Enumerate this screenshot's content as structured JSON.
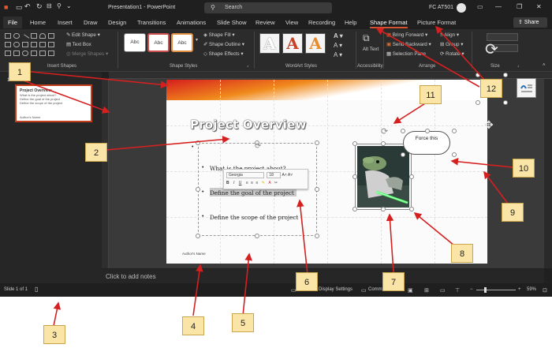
{
  "titlebar": {
    "title": "Presentation1 - PowerPoint",
    "search_placeholder": "Search",
    "user": "FC AT501"
  },
  "tabs": [
    "File",
    "Home",
    "Insert",
    "Draw",
    "Design",
    "Transitions",
    "Animations",
    "Slide Show",
    "Review",
    "View",
    "Recording",
    "Help",
    "Shape Format",
    "Picture Format"
  ],
  "share_label": "Share",
  "ribbon": {
    "insert_shapes": {
      "label": "Insert Shapes",
      "edit_shape": "Edit Shape",
      "text_box": "Text Box",
      "merge_shapes": "Merge Shapes"
    },
    "shape_styles": {
      "label": "Shape Styles",
      "style_sample": "Abc",
      "fill": "Shape Fill",
      "outline": "Shape Outline",
      "effects": "Shape Effects"
    },
    "wordart": {
      "label": "WordArt Styles",
      "letter": "A"
    },
    "accessibility": {
      "label": "Accessibility",
      "alt_text": "Alt Text"
    },
    "arrange": {
      "label": "Arrange",
      "bring_forward": "Bring Forward",
      "send_backward": "Send Backward",
      "selection_pane": "Selection Pane",
      "align": "Align",
      "group": "Group",
      "rotate": "Rotate"
    },
    "size": {
      "label": "Size"
    }
  },
  "thumbnail": {
    "number": "1",
    "title": "Project Overview",
    "lines": [
      "What is the project about?",
      "Define the goal of the project",
      "Define the scope of the project"
    ],
    "author": "Author's Name"
  },
  "slide": {
    "title": "Project Overview",
    "bullets": [
      "What is the project about?",
      "Define the goal of the project",
      "Define the scope of the project"
    ],
    "author": "Author's Name",
    "cloud_text": "Force this"
  },
  "mini_toolbar": {
    "font": "Georgia",
    "size": "18",
    "bold": "B",
    "italic": "I",
    "underline": "U"
  },
  "notes_placeholder": "Click to add notes",
  "status": {
    "slide": "Slide 1 of 1",
    "display_settings": "Display Settings",
    "comments": "Comments",
    "zoom": "59%"
  },
  "callouts": [
    "1",
    "2",
    "3",
    "4",
    "5",
    "6",
    "7",
    "8",
    "9",
    "10",
    "11",
    "12"
  ],
  "colors": {
    "accent": "#d35230",
    "callout_fill": "#fbe5a6",
    "arrow": "#d62020"
  }
}
